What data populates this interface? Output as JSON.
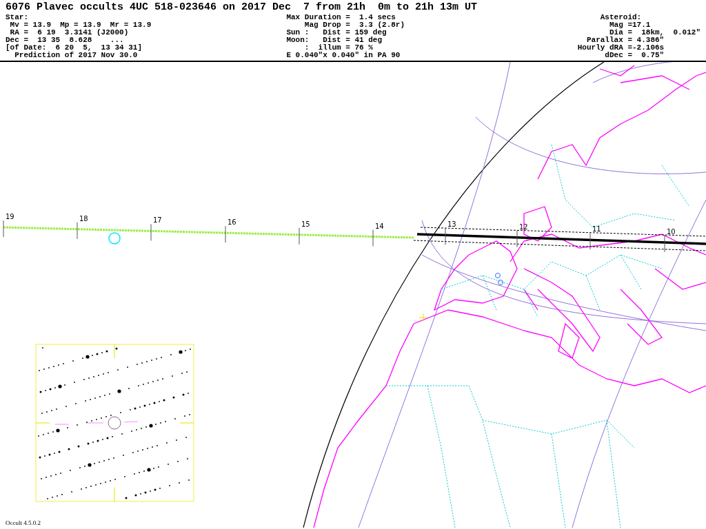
{
  "title": "6076 Plavec occults 4UC 518-023646 on 2017 Dec  7 from 21h  0m to 21h 13m UT",
  "star_info": [
    "Star:",
    " Mv = 13.9  Mp = 13.9  Mr = 13.9",
    " RA =  6 19  3.3141 (J2000)",
    "Dec =  13 35  8.628    ...",
    "[of Date:  6 20  5,  13 34 31]",
    "  Prediction of 2017 Nov 30.0"
  ],
  "event_info": [
    "Max Duration =  1.4 secs",
    "    Mag Drop =  3.3 (2.8r)",
    "Sun :   Dist = 159 deg",
    "Moon:   Dist = 41 deg",
    "    :  illum = 76 %",
    "E 0.040\"x 0.040\" in PA 90"
  ],
  "asteroid_info": [
    "     Asteroid:",
    "       Mag =17.1",
    "       Dia =  18km,  0.012\"",
    "  Parallax = 4.386\"",
    "Hourly dRA =-2.106s",
    "      dDec =  0.75\""
  ],
  "track_times": [
    "19",
    "18",
    "17",
    "16",
    "15",
    "14",
    "13",
    "12",
    "11",
    "10"
  ],
  "version": "Occult 4.5.0.2"
}
